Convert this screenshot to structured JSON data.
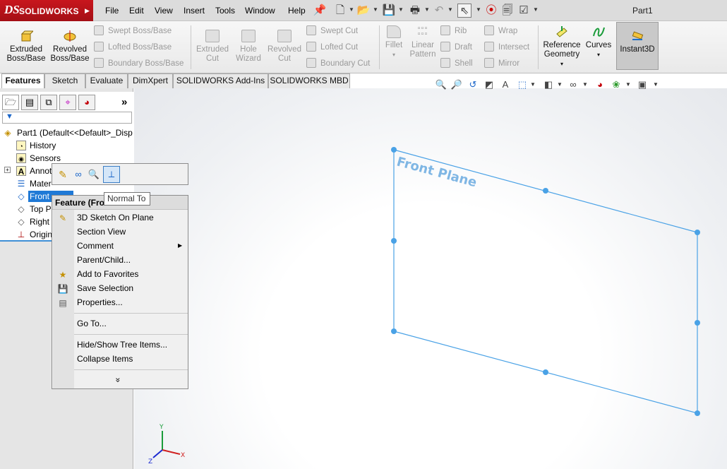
{
  "app": {
    "logo_ds": "DS",
    "logo_name": "SOLIDWORKS",
    "doc_title": "Part1",
    "menus": [
      "File",
      "Edit",
      "View",
      "Insert",
      "Tools",
      "Window",
      "Help"
    ]
  },
  "ribbon": {
    "extruded": [
      "Extruded",
      "Boss/Base"
    ],
    "revolved": [
      "Revolved",
      "Boss/Base"
    ],
    "swept_boss": "Swept Boss/Base",
    "lofted_boss": "Lofted Boss/Base",
    "boundary_boss": "Boundary Boss/Base",
    "extruded_cut": [
      "Extruded",
      "Cut"
    ],
    "hole_wizard": [
      "Hole",
      "Wizard"
    ],
    "revolved_cut": [
      "Revolved",
      "Cut"
    ],
    "swept_cut": "Swept Cut",
    "lofted_cut": "Lofted Cut",
    "boundary_cut": "Boundary Cut",
    "fillet": "Fillet",
    "linear_pattern": [
      "Linear",
      "Pattern"
    ],
    "rib": "Rib",
    "draft": "Draft",
    "shell": "Shell",
    "wrap": "Wrap",
    "intersect": "Intersect",
    "mirror": "Mirror",
    "reference_geometry": [
      "Reference",
      "Geometry"
    ],
    "curves": "Curves",
    "instant3d": "Instant3D"
  },
  "tabs": [
    "Features",
    "Sketch",
    "Evaluate",
    "DimXpert",
    "SOLIDWORKS Add-Ins",
    "SOLIDWORKS MBD"
  ],
  "tree": {
    "part": "Part1  (Default<<Default>_Disp",
    "history": "History",
    "sensors": "Sensors",
    "annotations": "Annot",
    "material": "Mater",
    "front": "Front",
    "top": "Top P",
    "right": "Right",
    "origin": "Origin"
  },
  "tooltip": "Normal To",
  "context_menu": {
    "header": "Feature (Fro",
    "items": [
      "3D Sketch On Plane",
      "Section View",
      "Comment",
      "Parent/Child...",
      "Add to Favorites",
      "Save Selection",
      "Properties...",
      "Go To...",
      "Hide/Show Tree Items...",
      "Collapse Items"
    ],
    "more": "»"
  },
  "viewport": {
    "plane_label": "Front Plane",
    "plane_color": "#4aa2e6",
    "triad": {
      "x": "X",
      "y": "Y",
      "z": "Z"
    }
  }
}
